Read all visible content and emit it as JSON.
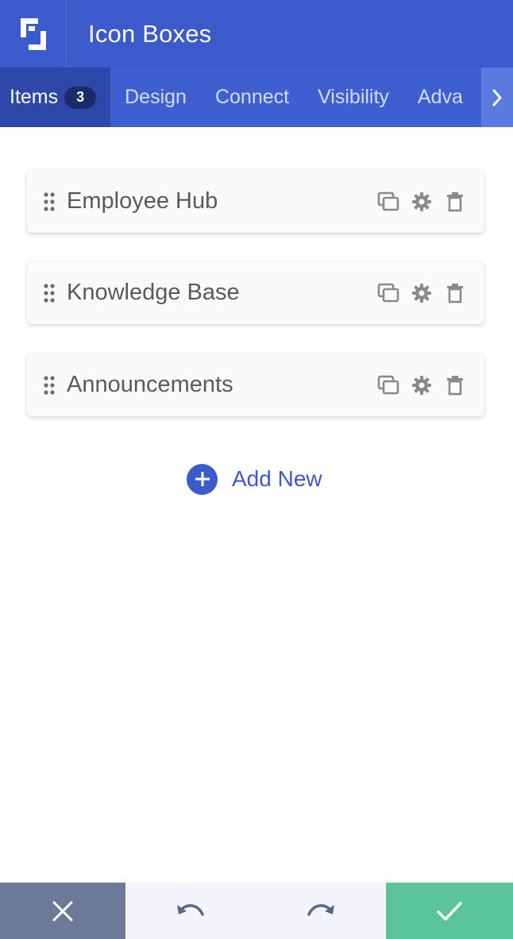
{
  "header": {
    "title": "Icon Boxes",
    "logo_icon": "logo-icon"
  },
  "tabs": [
    {
      "label": "Items",
      "badge": "3",
      "active": true
    },
    {
      "label": "Design"
    },
    {
      "label": "Connect"
    },
    {
      "label": "Visibility"
    },
    {
      "label": "Adva"
    }
  ],
  "items": [
    {
      "label": "Employee Hub"
    },
    {
      "label": "Knowledge Base"
    },
    {
      "label": "Announcements"
    }
  ],
  "add_new": {
    "label": "Add New"
  },
  "footer": {
    "cancel_icon": "close-icon",
    "undo_icon": "undo-icon",
    "redo_icon": "redo-icon",
    "save_icon": "check-icon"
  },
  "colors": {
    "primary": "#3b5bcc",
    "tab_active": "#2d48a8",
    "cancel": "#6b7a99",
    "save": "#5bc49a"
  }
}
